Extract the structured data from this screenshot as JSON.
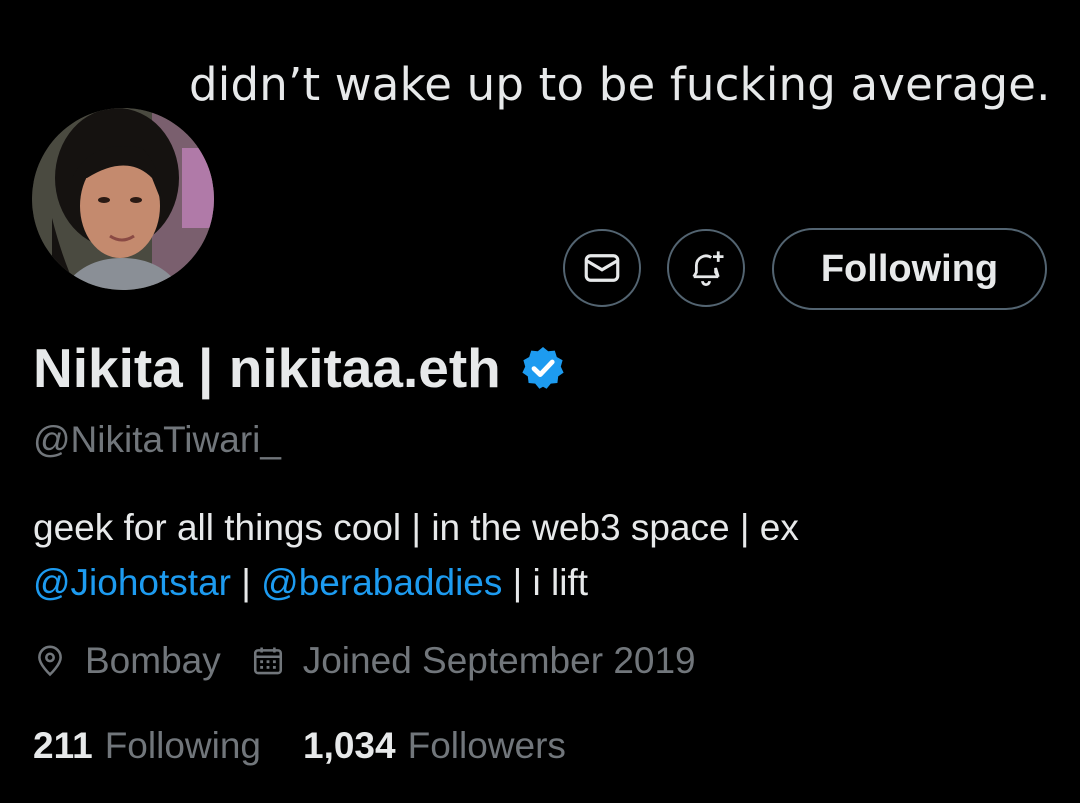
{
  "caption": "didn’t wake up to be fucking average.",
  "profile": {
    "display_name": "Nikita | nikitaa.eth",
    "handle": "@NikitaTiwari_",
    "verified": true,
    "bio": {
      "line1": "geek for all things cool | in the web3 space | ex",
      "mention1": "@Jiohotstar",
      "sep1": " | ",
      "mention2": "@berabaddies",
      "tail": " | i lift"
    },
    "location": "Bombay",
    "joined": "Joined September 2019",
    "following_count": "211",
    "following_label": "Following",
    "followers_count": "1,034",
    "followers_label": "Followers"
  },
  "actions": {
    "message_icon": "envelope-icon",
    "notify_icon": "bell-plus-icon",
    "follow_label": "Following"
  },
  "colors": {
    "background": "#000000",
    "text": "#e7e9ea",
    "muted": "#71767b",
    "accent": "#1d9bf0",
    "border": "#536471"
  }
}
